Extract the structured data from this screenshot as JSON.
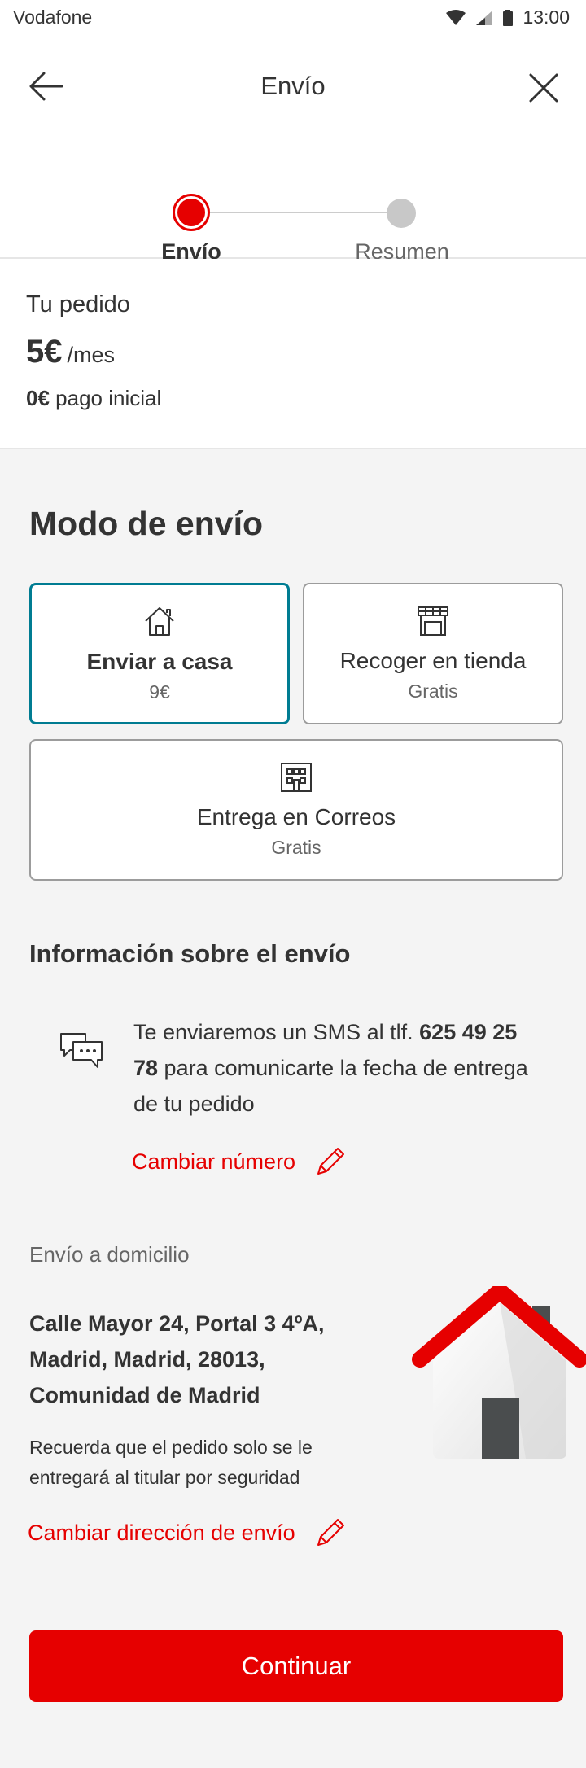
{
  "status_bar": {
    "carrier": "Vodafone",
    "time": "13:00"
  },
  "header": {
    "title": "Envío"
  },
  "stepper": {
    "steps": [
      {
        "label": "Envío"
      },
      {
        "label": "Resumen"
      }
    ]
  },
  "order": {
    "title": "Tu pedido",
    "price": "5€",
    "price_unit": "/mes",
    "initial_amount": "0€",
    "initial_label": "pago inicial"
  },
  "shipping_mode": {
    "title": "Modo de envío",
    "options": [
      {
        "label": "Enviar a casa",
        "price": "9€",
        "icon": "house-icon"
      },
      {
        "label": "Recoger en tienda",
        "price": "Gratis",
        "icon": "store-icon"
      },
      {
        "label": "Entrega en Correos",
        "price": "Gratis",
        "icon": "building-icon"
      }
    ]
  },
  "shipping_info": {
    "title": "Información sobre el envío",
    "sms_prefix": "Te enviaremos un SMS al tlf. ",
    "phone": "625 49 25 78",
    "sms_suffix": " para comunicarte la fecha de entrega de tu pedido",
    "change_number": "Cambiar número"
  },
  "home_delivery": {
    "label": "Envío a domicilio",
    "address": "Calle Mayor 24, Portal 3 4ºA, Madrid, Madrid, 28013, Comunidad de Madrid",
    "note": "Recuerda que el pedido solo se le entregará al titular por seguridad",
    "change_address": "Cambiar dirección de envío"
  },
  "continue_label": "Continuar",
  "colors": {
    "brand_red": "#e60000",
    "selected_border": "#007c92"
  }
}
